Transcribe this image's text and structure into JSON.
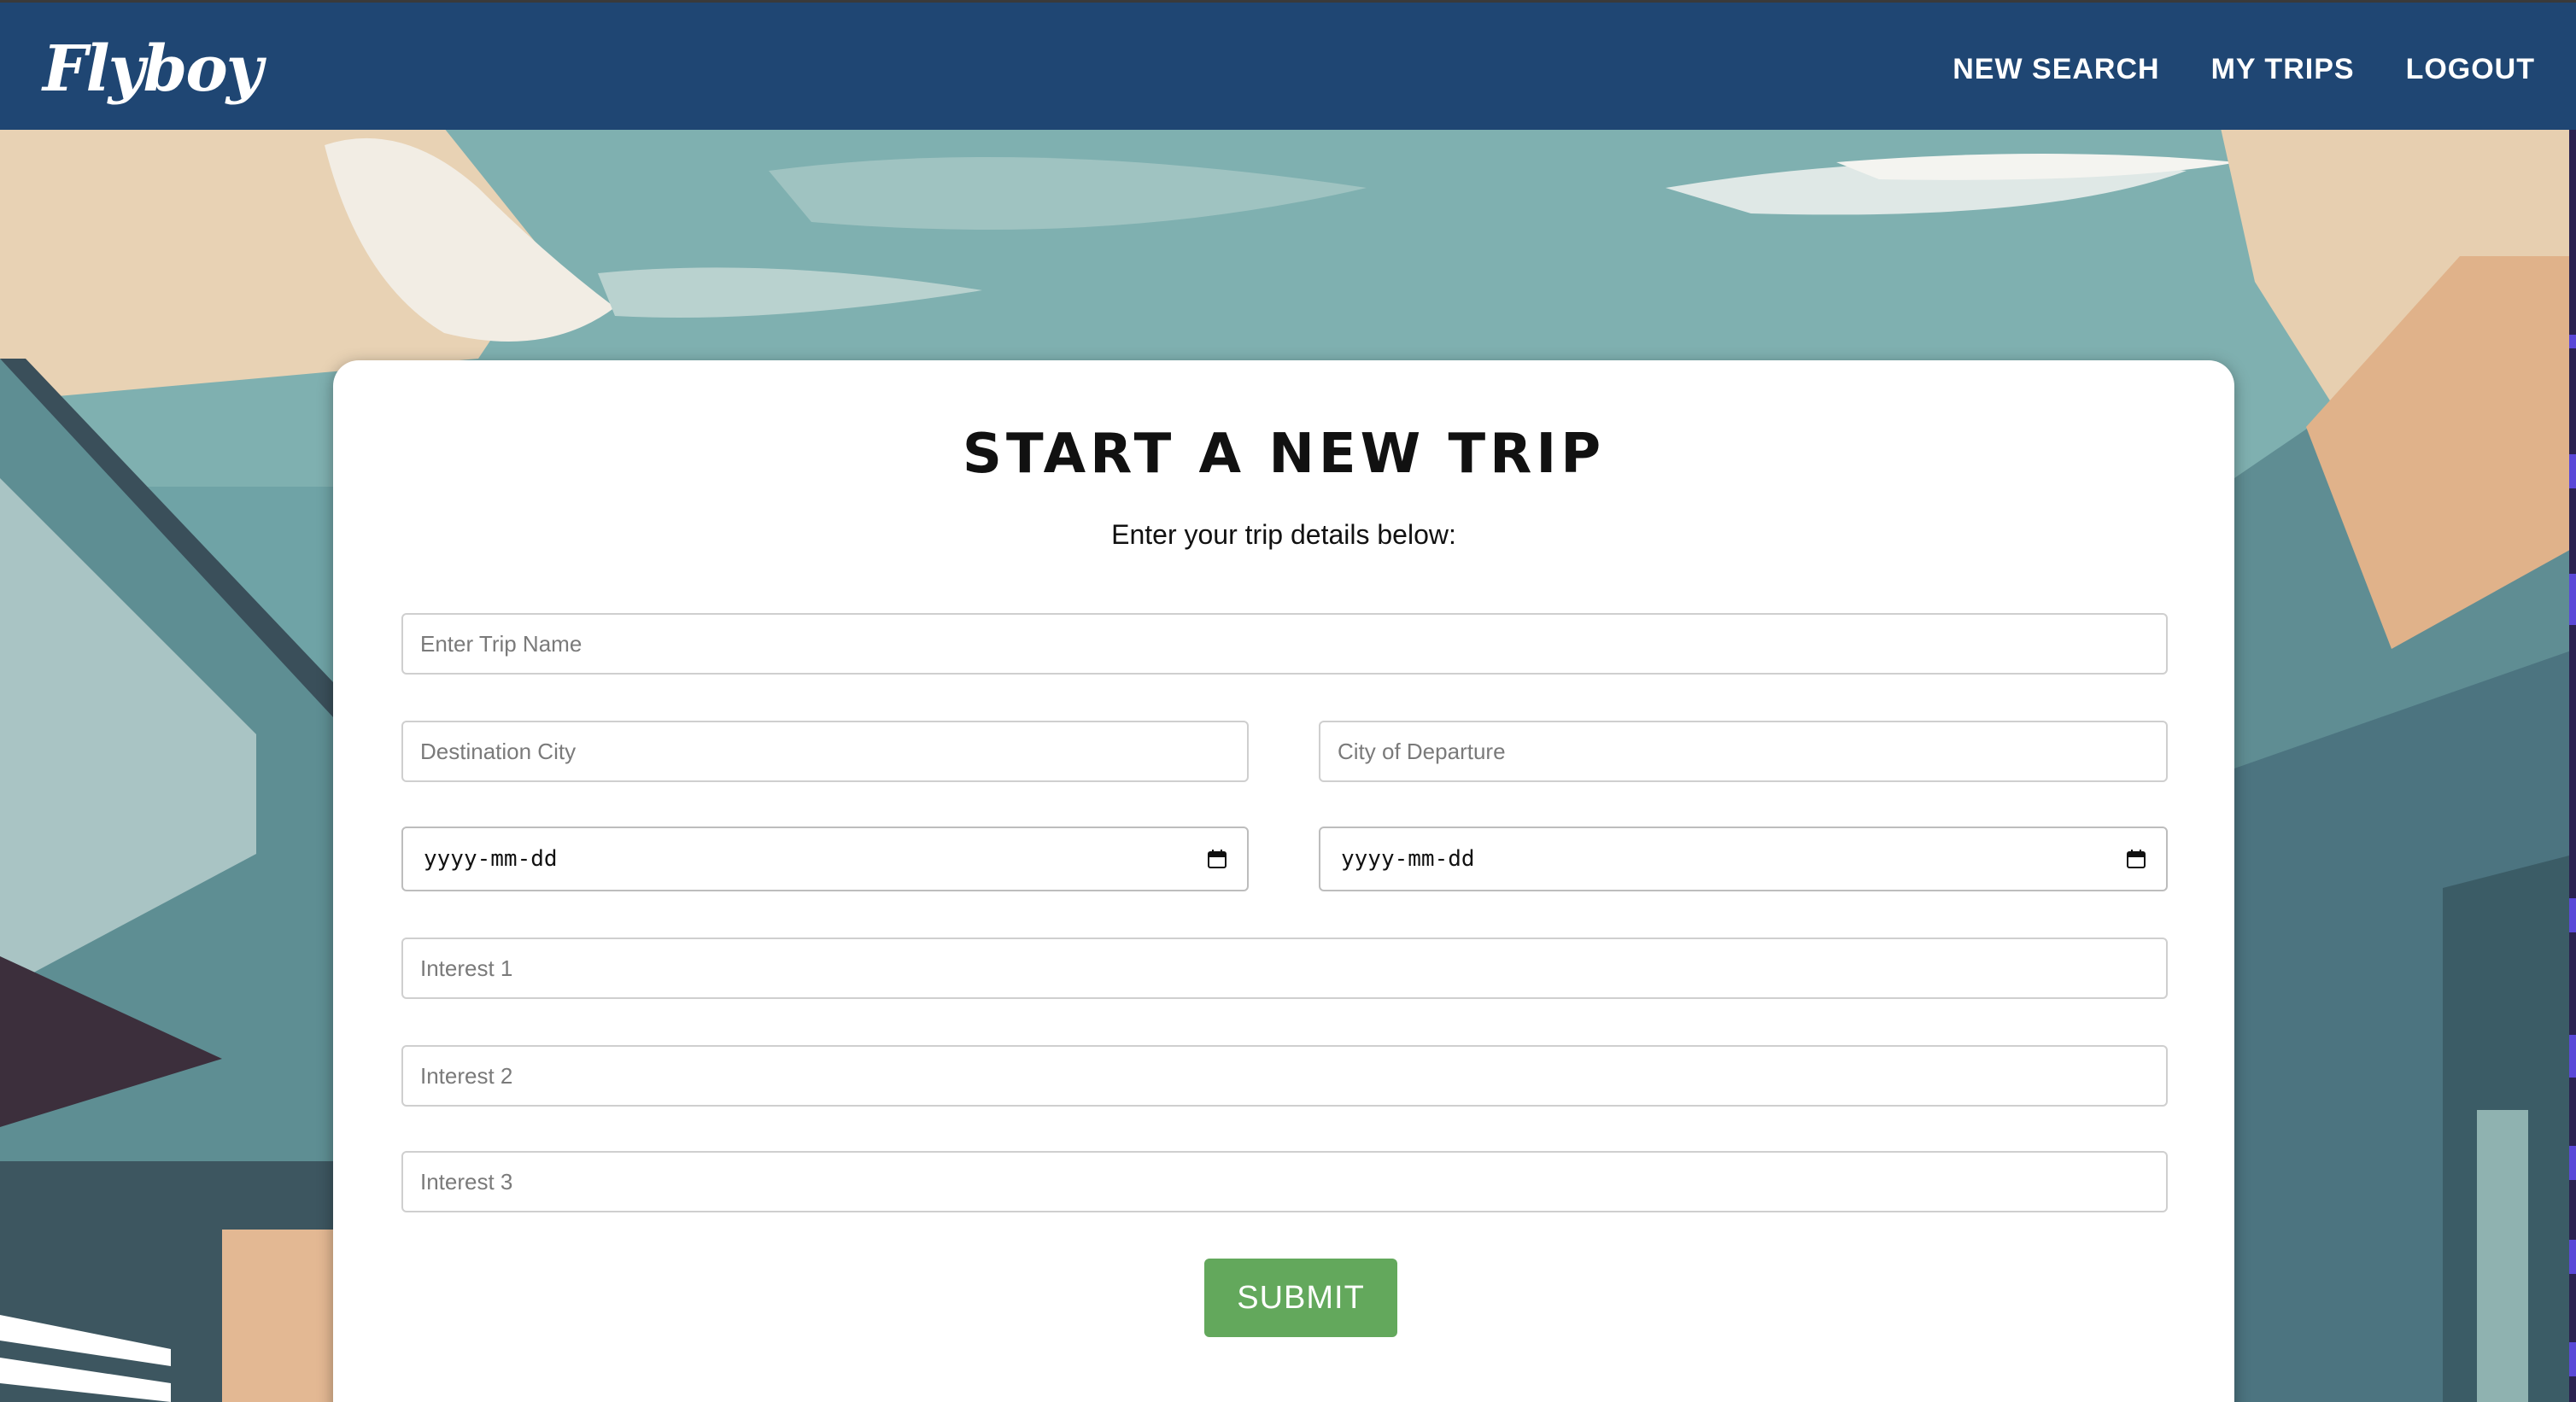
{
  "app": {
    "brand": "Flyboy"
  },
  "nav": {
    "items": [
      {
        "label": "NEW SEARCH"
      },
      {
        "label": "MY TRIPS"
      },
      {
        "label": "LOGOUT"
      }
    ]
  },
  "form": {
    "title": "START A NEW TRIP",
    "subtitle": "Enter your trip details below:",
    "trip_name_placeholder": "Enter Trip Name",
    "destination_placeholder": "Destination City",
    "departure_placeholder": "City of Departure",
    "start_date_text": "yyyy-mm-dd",
    "end_date_text": "yyyy-mm-dd",
    "interest1_placeholder": "Interest 1",
    "interest2_placeholder": "Interest 2",
    "interest3_placeholder": "Interest 3",
    "submit_label": "SUBMIT"
  },
  "colors": {
    "navbar": "#1f4673",
    "submit": "#63a85c",
    "card": "#ffffff"
  },
  "icons": {
    "date_picker": "calendar-icon"
  }
}
